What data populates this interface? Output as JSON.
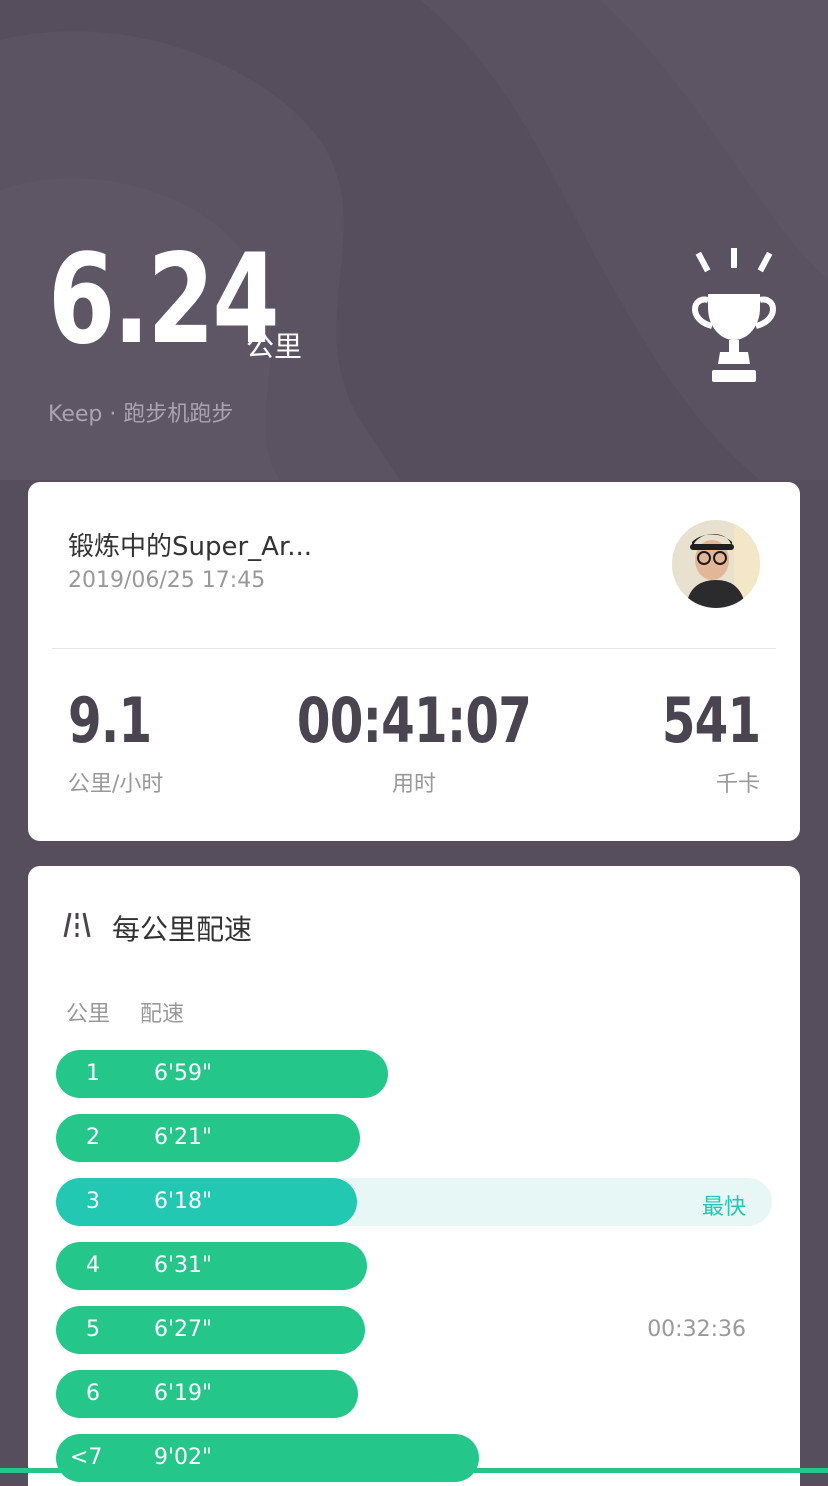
{
  "hero": {
    "distance": "6.24",
    "unit": "公里",
    "subtitle": "Keep · 跑步机跑步",
    "trophy_icon": "trophy-icon"
  },
  "user_card": {
    "name": "锻炼中的Super_Ar...",
    "datetime": "2019/06/25 17:45",
    "stats": [
      {
        "value": "9.1",
        "label": "公里/小时"
      },
      {
        "value": "00:41:07",
        "label": "用时"
      },
      {
        "value": "541",
        "label": "千卡"
      }
    ]
  },
  "pace": {
    "title": "每公里配速",
    "icon": "road-icon",
    "col_km": "公里",
    "col_pace": "配速",
    "fastest_label": "最快",
    "rows": [
      {
        "km": "1",
        "pace": "6'59\"",
        "bar_ratio": 0.463,
        "right": ""
      },
      {
        "km": "2",
        "pace": "6'21\"",
        "bar_ratio": 0.424,
        "right": ""
      },
      {
        "km": "3",
        "pace": "6'18\"",
        "bar_ratio": 0.42,
        "right": "最快",
        "fastest": true
      },
      {
        "km": "4",
        "pace": "6'31\"",
        "bar_ratio": 0.435,
        "right": ""
      },
      {
        "km": "5",
        "pace": "6'27\"",
        "bar_ratio": 0.431,
        "right": "00:32:36"
      },
      {
        "km": "6",
        "pace": "6'19\"",
        "bar_ratio": 0.422,
        "right": ""
      },
      {
        "km": "<7",
        "pace": "9'02\"",
        "bar_ratio": 0.591,
        "right": ""
      }
    ]
  },
  "colors": {
    "background": "#574e5d",
    "bar_green": "#24c789",
    "bar_fastest": "#22c8b1",
    "track": "#e7f7f5"
  }
}
